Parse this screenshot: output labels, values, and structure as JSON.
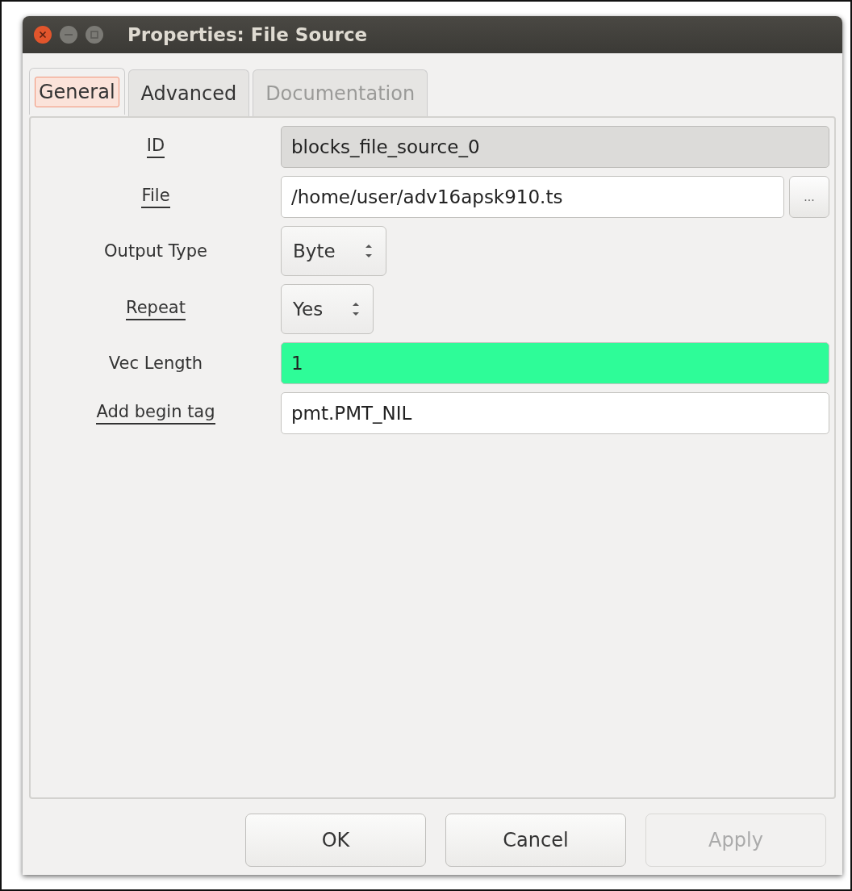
{
  "window": {
    "title": "Properties: File Source"
  },
  "tabs": [
    {
      "label": "General",
      "selected": true,
      "disabled": false
    },
    {
      "label": "Advanced",
      "selected": false,
      "disabled": false
    },
    {
      "label": "Documentation",
      "selected": false,
      "disabled": true
    }
  ],
  "params": [
    {
      "label": "ID",
      "underlined": true,
      "kind": "text",
      "value": "blocks_file_source_0",
      "disabled": true,
      "highlighted": false
    },
    {
      "label": "File",
      "underlined": true,
      "kind": "file",
      "value": "/home/user/adv16apsk910.ts",
      "disabled": false,
      "highlighted": false,
      "browse": "..."
    },
    {
      "label": "Output Type",
      "underlined": false,
      "kind": "select",
      "value": "Byte"
    },
    {
      "label": "Repeat",
      "underlined": true,
      "kind": "select",
      "value": "Yes"
    },
    {
      "label": "Vec Length",
      "underlined": false,
      "kind": "text",
      "value": "1",
      "disabled": false,
      "highlighted": true
    },
    {
      "label": "Add begin tag",
      "underlined": true,
      "kind": "text",
      "value": "pmt.PMT_NIL",
      "disabled": false,
      "highlighted": false
    }
  ],
  "buttons": [
    {
      "label": "OK",
      "disabled": false
    },
    {
      "label": "Cancel",
      "disabled": false
    },
    {
      "label": "Apply",
      "disabled": true
    }
  ]
}
